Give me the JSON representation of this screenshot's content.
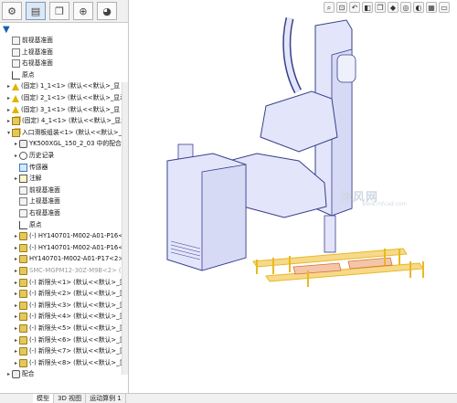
{
  "panel_tabs": [
    {
      "name": "feature-manager-tab",
      "glyph": "⚙"
    },
    {
      "name": "property-manager-tab",
      "glyph": "▤"
    },
    {
      "name": "configuration-manager-tab",
      "glyph": "❐"
    },
    {
      "name": "dimxpert-tab",
      "glyph": "⊕"
    },
    {
      "name": "display-manager-tab",
      "glyph": "◕"
    }
  ],
  "filter_icon": "filter-icon",
  "tree": [
    {
      "label": "前视基准面",
      "icon": "plane",
      "expand": "",
      "indent": 6
    },
    {
      "label": "上视基准面",
      "icon": "plane",
      "expand": "",
      "indent": 6
    },
    {
      "label": "右视基准面",
      "icon": "plane",
      "expand": "",
      "indent": 6
    },
    {
      "label": "原点",
      "icon": "origin",
      "expand": "",
      "indent": 6
    },
    {
      "label": "(固定) 1_1<1> (默认<<默认>_显",
      "icon": "warn",
      "expand": "▸",
      "indent": 6
    },
    {
      "label": "(固定) 2_1<1> (默认<<默认>_显示",
      "icon": "warn",
      "expand": "▸",
      "indent": 6
    },
    {
      "label": "(固定) 3_1<1> (默认<<默认>_显",
      "icon": "warn",
      "expand": "▸",
      "indent": 6
    },
    {
      "label": "(固定) 4_1<1> (默认<<默认>_显示状",
      "icon": "asm",
      "expand": "▸",
      "indent": 6
    },
    {
      "label": "入口滑板组装<1> (默认<<默认>_显示状",
      "icon": "asm",
      "expand": "▾",
      "indent": 6
    },
    {
      "label": "YK500XGL_150_2_03 中的配合",
      "icon": "mate",
      "expand": "▸",
      "indent": 14
    },
    {
      "label": "历史记录",
      "icon": "hist",
      "expand": "▸",
      "indent": 14
    },
    {
      "label": "传感器",
      "icon": "sensor",
      "expand": "",
      "indent": 14
    },
    {
      "label": "注解",
      "icon": "note",
      "expand": "▸",
      "indent": 14
    },
    {
      "label": "前视基准面",
      "icon": "plane",
      "expand": "",
      "indent": 14
    },
    {
      "label": "上视基准面",
      "icon": "plane",
      "expand": "",
      "indent": 14
    },
    {
      "label": "右视基准面",
      "icon": "plane",
      "expand": "",
      "indent": 14
    },
    {
      "label": "原点",
      "icon": "origin",
      "expand": "",
      "indent": 14
    },
    {
      "label": "(-) HY140701-M002-A01-P16<1>",
      "icon": "part",
      "expand": "▸",
      "indent": 14
    },
    {
      "label": "(-) HY140701-M002-A01-P16<2>",
      "icon": "part",
      "expand": "▸",
      "indent": 14
    },
    {
      "label": "HY140701-M002-A01-P17<2> (默",
      "icon": "part",
      "expand": "▸",
      "indent": 14
    },
    {
      "label": "SMC-MGPM12-30Z-M9B<2> (默认",
      "icon": "part",
      "expand": "▸",
      "indent": 14,
      "gray": true
    },
    {
      "label": "(-) 新限头<1> (默认<<默认>_显示状",
      "icon": "part",
      "expand": "▸",
      "indent": 14
    },
    {
      "label": "(-) 新限头<2> (默认<<默认>_显示状",
      "icon": "part",
      "expand": "▸",
      "indent": 14
    },
    {
      "label": "(-) 新限头<3> (默认<<默认>_显示状",
      "icon": "part",
      "expand": "▸",
      "indent": 14
    },
    {
      "label": "(-) 新限头<4> (默认<<默认>_显示状",
      "icon": "part",
      "expand": "▸",
      "indent": 14
    },
    {
      "label": "(-) 新限头<5> (默认<<默认>_显示状",
      "icon": "part",
      "expand": "▸",
      "indent": 14
    },
    {
      "label": "(-) 新限头<6> (默认<<默认>_显示状",
      "icon": "part",
      "expand": "▸",
      "indent": 14
    },
    {
      "label": "(-) 新限头<7> (默认<<默认>_显示状",
      "icon": "part",
      "expand": "▸",
      "indent": 14
    },
    {
      "label": "(-) 新限头<8> (默认<<默认>_显示状",
      "icon": "part",
      "expand": "▸",
      "indent": 14
    },
    {
      "label": "配合",
      "icon": "mate",
      "expand": "▸",
      "indent": 6
    }
  ],
  "bottom_tabs": [
    "模型",
    "3D 视图",
    "运动算例 1"
  ],
  "view_toolbar": [
    {
      "name": "zoom-fit-icon",
      "glyph": "⌕"
    },
    {
      "name": "zoom-area-icon",
      "glyph": "⊡"
    },
    {
      "name": "previous-view-icon",
      "glyph": "↶"
    },
    {
      "name": "section-view-icon",
      "glyph": "◧"
    },
    {
      "name": "view-orientation-icon",
      "glyph": "❒"
    },
    {
      "name": "display-style-icon",
      "glyph": "◆"
    },
    {
      "name": "hide-show-icon",
      "glyph": "◎"
    },
    {
      "name": "appearance-icon",
      "glyph": "◐"
    },
    {
      "name": "scene-icon",
      "glyph": "▦"
    },
    {
      "name": "view-settings-icon",
      "glyph": "▭"
    }
  ],
  "watermark": {
    "main": "沐风网",
    "sub": "www.mfcad.com"
  },
  "colors": {
    "model_fill": "#e3e6fb",
    "model_edge": "#3a3f8a",
    "fixture_yellow": "#e8b923",
    "fixture_orange": "#d96a3a"
  }
}
